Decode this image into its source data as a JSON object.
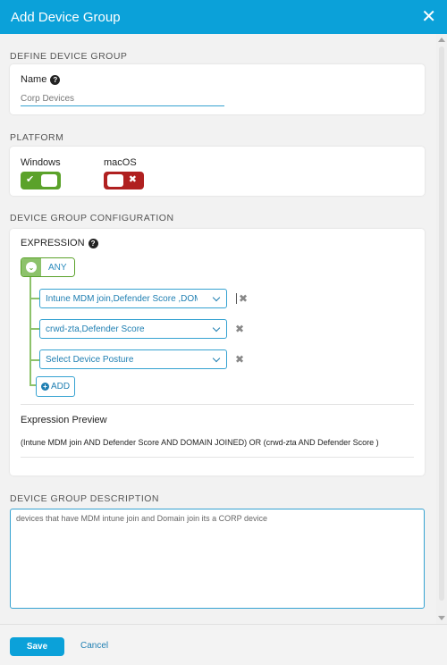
{
  "dialog": {
    "title": "Add Device Group",
    "close_icon": "close-icon"
  },
  "define": {
    "section_label": "DEFINE DEVICE GROUP",
    "name_label": "Name",
    "name_value": "Corp Devices"
  },
  "platform": {
    "section_label": "PLATFORM",
    "windows": {
      "label": "Windows",
      "enabled": true
    },
    "macos": {
      "label": "macOS",
      "enabled": false
    }
  },
  "config": {
    "section_label": "DEVICE GROUP CONFIGURATION",
    "expression_label": "EXPRESSION",
    "operator": "ANY",
    "conditions": [
      "Intune MDM join,Defender Score ,DOMAIN JOINED",
      "crwd-zta,Defender Score",
      "Select Device Posture"
    ],
    "add_label": "ADD",
    "preview_label": "Expression Preview",
    "preview_text": "(Intune MDM join AND Defender Score AND DOMAIN JOINED) OR (crwd-zta AND Defender Score )"
  },
  "description": {
    "section_label": "DEVICE GROUP DESCRIPTION",
    "value": "devices that have MDM intune join and Domain join its a CORP device"
  },
  "footer": {
    "save_label": "Save",
    "cancel_label": "Cancel"
  },
  "colors": {
    "accent": "#0ba1d9",
    "enabled": "#5ba22a",
    "disabled": "#b02020"
  }
}
